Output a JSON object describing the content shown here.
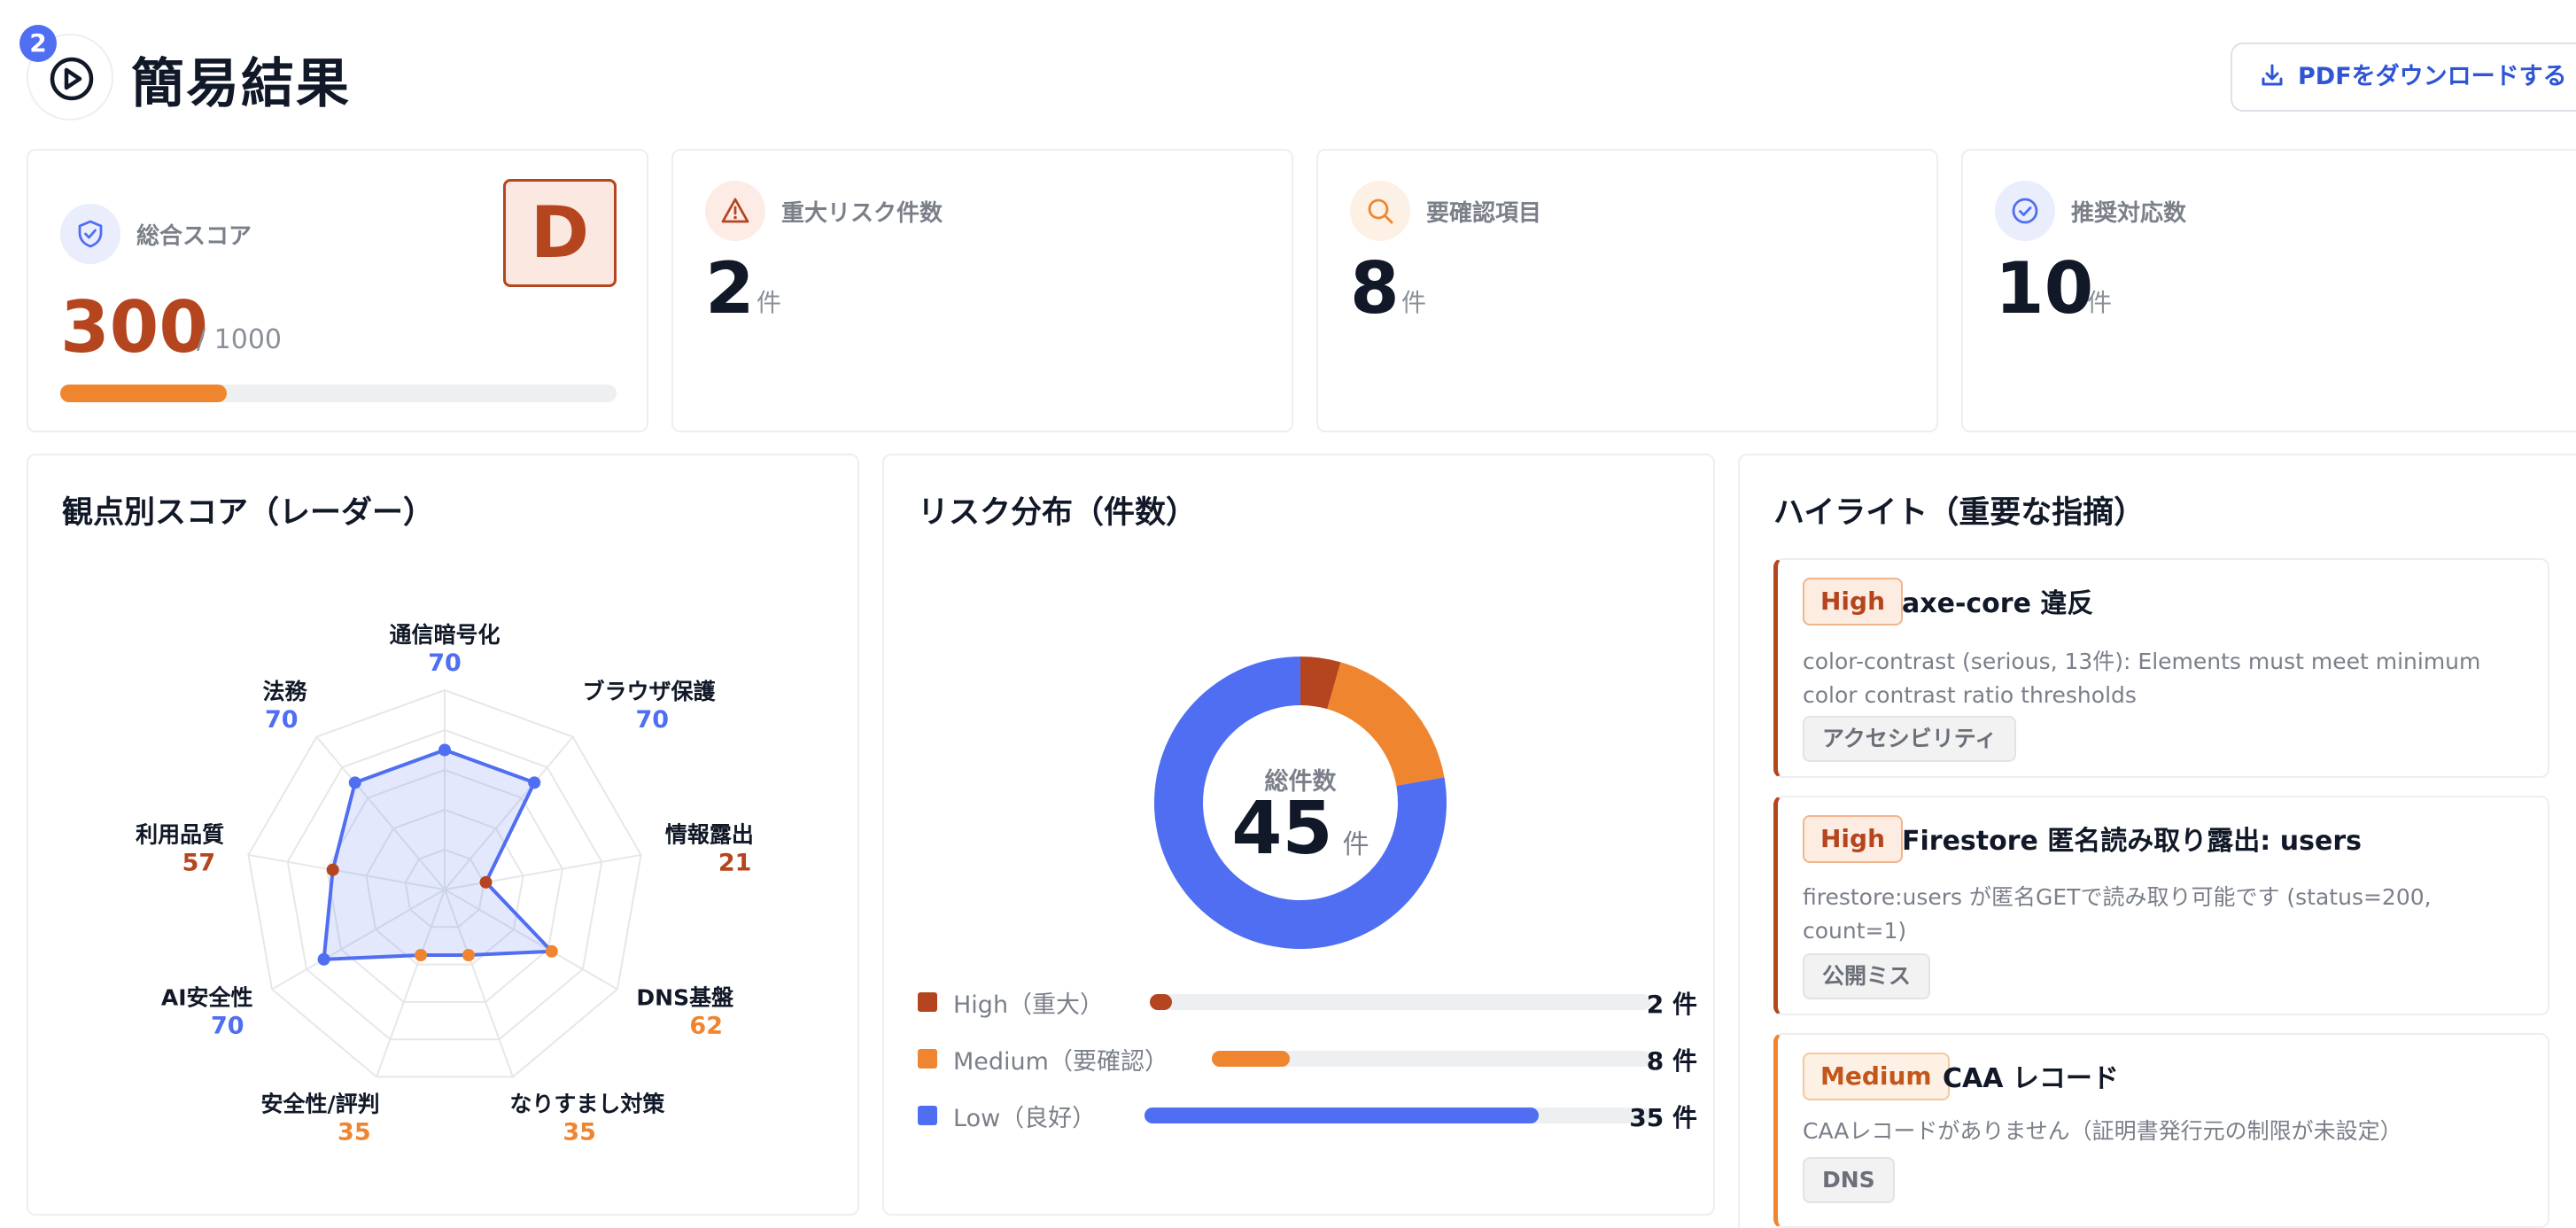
{
  "header": {
    "step_number": "2",
    "title": "簡易結果",
    "pdf_button_label": "PDFをダウンロードする"
  },
  "kpis": {
    "score": {
      "label": "総合スコア",
      "value": "300",
      "max": "/ 1000",
      "grade": "D",
      "progress": 0.3
    },
    "critical": {
      "label": "重大リスク件数",
      "value": "2",
      "unit": "件"
    },
    "review": {
      "label": "要確認項目",
      "value": "8",
      "unit": "件"
    },
    "actions": {
      "label": "推奨対応数",
      "value": "10",
      "unit": "件"
    }
  },
  "radar": {
    "title": "観点別スコア（レーダー）",
    "max": 100,
    "axes": [
      {
        "name": "通信暗号化",
        "value": 70,
        "color": "#4f6ef2"
      },
      {
        "name": "ブラウザ保護",
        "value": 70,
        "color": "#4f6ef2"
      },
      {
        "name": "情報露出",
        "value": 21,
        "color": "#b5451f"
      },
      {
        "name": "DNS基盤",
        "value": 62,
        "color": "#f0852f"
      },
      {
        "name": "なりすまし対策",
        "value": 35,
        "color": "#f0852f"
      },
      {
        "name": "安全性/評判",
        "value": 35,
        "color": "#f0852f"
      },
      {
        "name": "AI安全性",
        "value": 70,
        "color": "#4f6ef2"
      },
      {
        "name": "利用品質",
        "value": 57,
        "color": "#b5451f"
      },
      {
        "name": "法務",
        "value": 70,
        "color": "#4f6ef2"
      }
    ]
  },
  "risk": {
    "title": "リスク分布（件数）",
    "center_label": "総件数",
    "total": "45",
    "total_unit": "件",
    "segments": [
      {
        "label": "High（重大）",
        "value": 2,
        "count_text": "2 件",
        "color": "#b5451f"
      },
      {
        "label": "Medium（要確認）",
        "value": 8,
        "count_text": "8 件",
        "color": "#f0852f"
      },
      {
        "label": "Low（良好）",
        "value": 35,
        "count_text": "35 件",
        "color": "#4f6ef2"
      }
    ]
  },
  "highlights": {
    "title": "ハイライト（重要な指摘）",
    "items": [
      {
        "severity": "High",
        "title": "axe-core 違反",
        "description": "color-contrast (serious, 13件): Elements must meet minimum color contrast ratio thresholds",
        "tag": "アクセシビリティ"
      },
      {
        "severity": "High",
        "title": "Firestore 匿名読み取り露出: users",
        "description": "firestore:users が匿名GETで読み取り可能です (status=200, count=1)",
        "tag": "公開ミス"
      },
      {
        "severity": "Medium",
        "title": "CAA レコード",
        "description": "CAAレコードがありません（証明書発行元の制限が未設定）",
        "tag": "DNS"
      }
    ]
  },
  "colors": {
    "accent_blue": "#4f6ef2",
    "high_red": "#b5451f",
    "medium_orange": "#f0852f",
    "medium_border": "#f0852f"
  }
}
